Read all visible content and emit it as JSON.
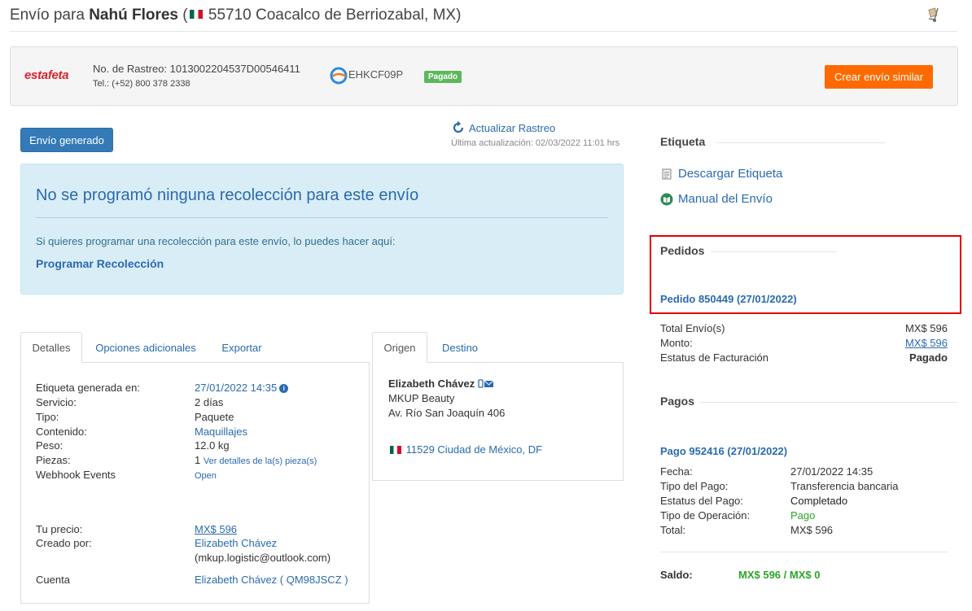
{
  "header": {
    "prefix": "Envío para",
    "recipient_name": "Nahú Flores",
    "open_paren": "(",
    "address": "55710 Coacalco de Berriozabal, MX)"
  },
  "carrier": {
    "logo_text": "estafeta",
    "tracking": "No. de Rastreo: 1013002204537D00546411",
    "phone": "Tel.: (+52) 800 378 2338",
    "envia_code": "EHKCF09P",
    "paid_badge": "Pagado",
    "similar_button": "Crear envío similar"
  },
  "status": {
    "button": "Envío generado",
    "refresh_link": "Actualizar Rastreo",
    "last_update": "Última actualización: 02/03/2022 11:01 hrs"
  },
  "pickup": {
    "title": "No se programó ninguna recolección para este envío",
    "text": "Si quieres programar una recolección para este envío, lo puedes hacer aquí:",
    "link": "Programar Recolección"
  },
  "details_tabs": [
    "Detalles",
    "Opciones adicionales",
    "Exportar"
  ],
  "details": {
    "label_generated_label": "Etiqueta generada en:",
    "label_generated_value": "27/01/2022 14:35",
    "service_label": "Servicio:",
    "service_value": "2 días",
    "type_label": "Tipo:",
    "type_value": "Paquete",
    "content_label": "Contenido:",
    "content_value": "Maquillajes",
    "weight_label": "Peso:",
    "weight_value": "12.0 kg",
    "pieces_label": "Piezas:",
    "pieces_value": "1",
    "pieces_link": "Ver detalles de la(s) pieza(s)",
    "webhook_label": "Webhook Events",
    "webhook_value": "Open",
    "price_label": "Tu precio:",
    "price_value": "MX$ 596",
    "created_label": "Creado por:",
    "created_value": "Elizabeth Chávez",
    "created_email": "(mkup.logistic@outlook.com)",
    "account_label": "Cuenta",
    "account_name": "Elizabeth Chávez",
    "account_open": " ( ",
    "account_code": "QM98JSCZ",
    "account_close": " )"
  },
  "address_tabs": [
    "Origen",
    "Destino"
  ],
  "origin": {
    "name": "Elizabeth Chávez",
    "company": "MKUP Beauty",
    "street": "Av. Río San Joaquín 406",
    "city": "11529 Ciudad de México, DF"
  },
  "label_section": {
    "title": "Etiqueta",
    "download": "Descargar Etiqueta",
    "manual": "Manual del Envío"
  },
  "orders": {
    "title": "Pedidos",
    "order_link": "Pedido 850449 (27/01/2022)",
    "total_label": "Total Envío(s)",
    "total_value": "MX$ 596",
    "amount_label": "Monto:",
    "amount_value": "MX$ 596",
    "billing_label": "Estatus de Facturación",
    "billing_value": "Pagado"
  },
  "payments": {
    "title": "Pagos",
    "payment_link": "Pago 952416 (27/01/2022)",
    "date_label": "Fecha:",
    "date_value": "27/01/2022 14:35",
    "type_label": "Tipo del Pago:",
    "type_value": "Transferencia bancaria",
    "status_label": "Estatus del Pago:",
    "status_value": "Completado",
    "op_label": "Tipo de Operación:",
    "op_value": "Pago",
    "total_label": "Total:",
    "total_value": "MX$ 596",
    "balance_label": "Saldo:",
    "balance_value": "MX$ 596 / MX$ 0"
  },
  "colors": {
    "primary_link": "#2a6ab0",
    "orange_button": "#ff6a00",
    "paid_green": "#5cb85c",
    "highlight_red": "#e00000"
  }
}
